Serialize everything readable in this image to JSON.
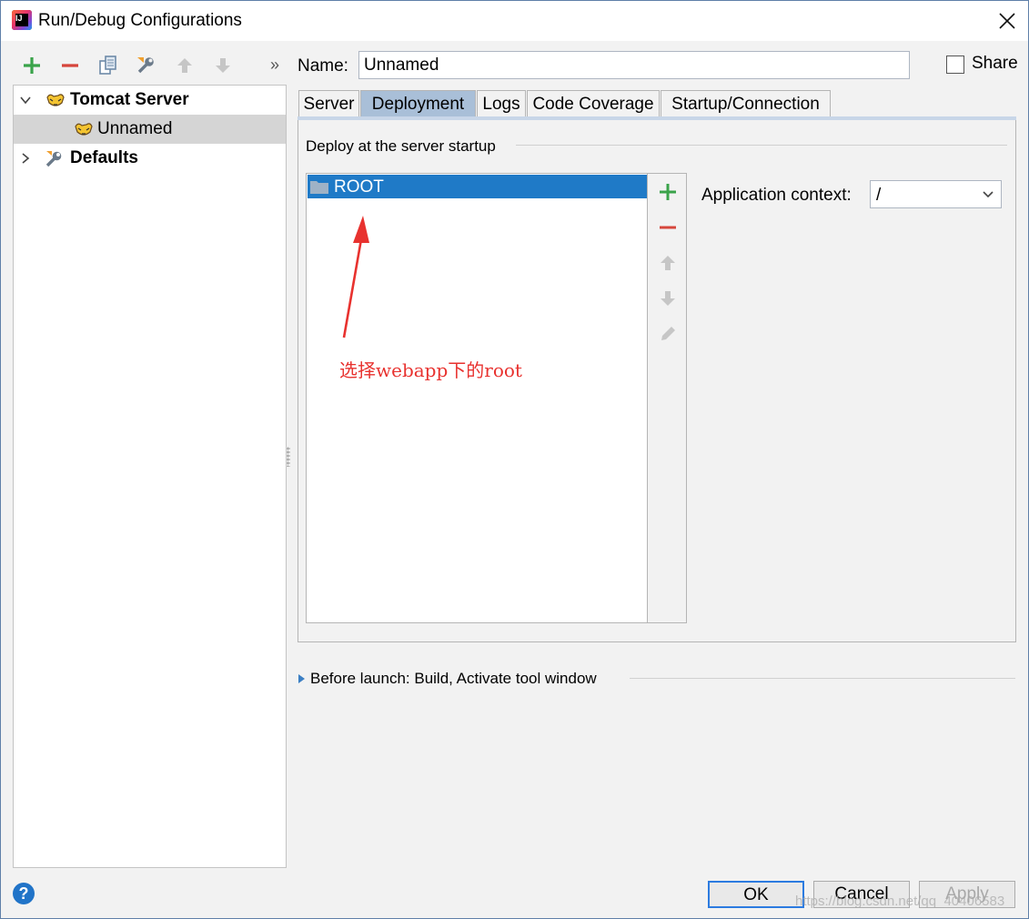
{
  "window": {
    "title": "Run/Debug Configurations",
    "app_logo_text": "IJ"
  },
  "toolbar": {
    "icons": [
      "add-icon",
      "remove-icon",
      "copy-icon",
      "edit-defaults-icon",
      "move-up-icon",
      "move-down-icon",
      "more-icon"
    ],
    "more_label": "»"
  },
  "tree": {
    "items": [
      {
        "label": "Tomcat Server",
        "expanded": true,
        "bold": true
      },
      {
        "label": "Unnamed",
        "selected": true
      },
      {
        "label": "Defaults",
        "expanded": false,
        "bold": true
      }
    ]
  },
  "name_field": {
    "label": "Name:",
    "value": "Unnamed"
  },
  "share": {
    "label": "Share",
    "checked": false
  },
  "tabs": [
    "Server",
    "Deployment",
    "Logs",
    "Code Coverage",
    "Startup/Connection"
  ],
  "active_tab": "Deployment",
  "deployment": {
    "group_label": "Deploy at the server startup",
    "items": [
      "ROOT"
    ],
    "app_context": {
      "label": "Application context:",
      "value": "/"
    }
  },
  "annotation": {
    "text": "选择webapp下的root"
  },
  "before_launch": {
    "label": "Before launch: Build, Activate tool window"
  },
  "buttons": {
    "ok": "OK",
    "cancel": "Cancel",
    "apply": "Apply"
  },
  "help_label": "?",
  "watermark": "https://blog.csdn.net/qq_40406583",
  "colors": {
    "accent": "#1f7ac7",
    "tab_active": "#a9bfd8",
    "annotation": "#e8322f",
    "add_green": "#3aa34a",
    "remove_red": "#d6463c"
  }
}
